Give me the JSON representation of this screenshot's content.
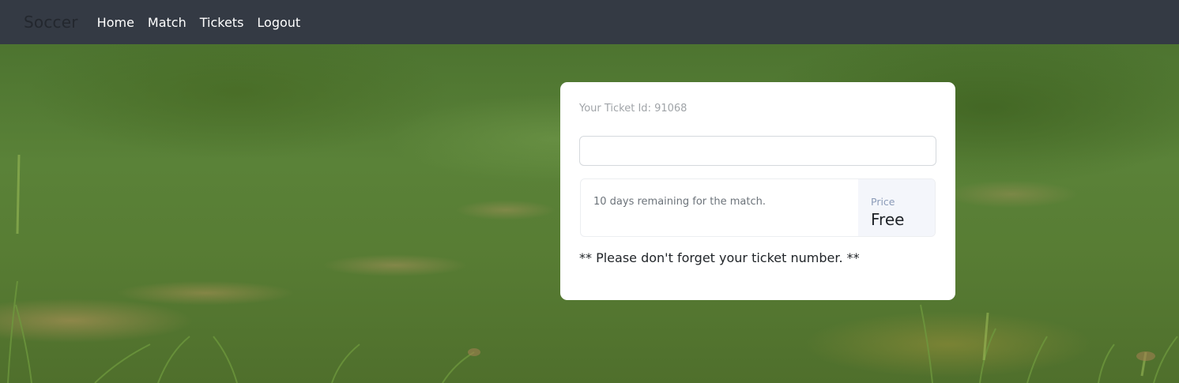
{
  "navbar": {
    "brand": "Soccer",
    "links": [
      "Home",
      "Match",
      "Tickets",
      "Logout"
    ]
  },
  "card": {
    "ticket_id_text": "Your Ticket Id: 91068",
    "input_value": "",
    "remaining_text": "10 days remaining for the match.",
    "price_label": "Price",
    "price_value": "Free",
    "reminder": "** Please don't forget your ticket number. **"
  },
  "colors": {
    "navbar_bg": "#343a44",
    "brand": "#23272e",
    "nav_link": "#ffffff",
    "card_bg": "#ffffff",
    "price_panel_bg": "#f4f6fb",
    "grass": "#5a8238"
  },
  "background": {
    "image": "grass-field-photo"
  }
}
